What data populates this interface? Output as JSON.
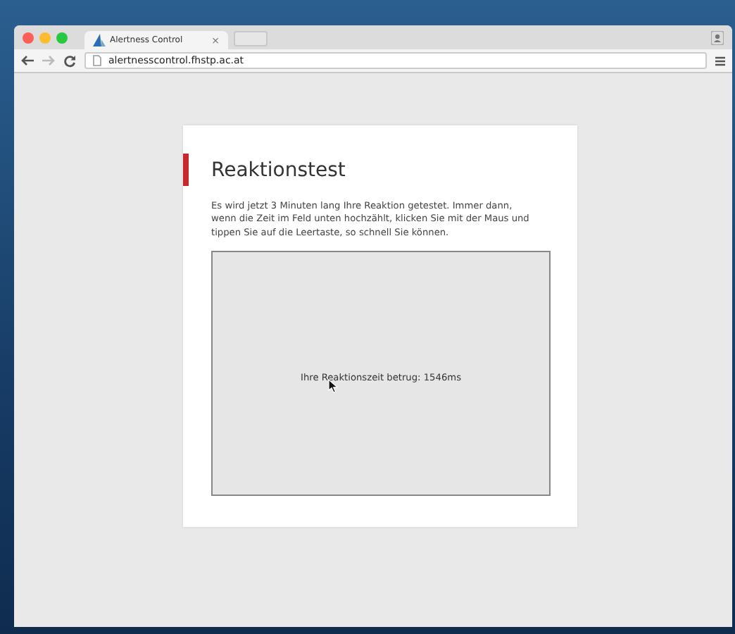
{
  "browser": {
    "tab": {
      "title": "Alertness Control",
      "close": "×",
      "selected": true
    },
    "url": "alertnesscontrol.fhstp.ac.at"
  },
  "card": {
    "title": "Reaktionstest",
    "text": "Es wird jetzt 3 Minuten lang Ihre Reaktion getestet. Immer dann, wenn die Zeit im Feld unten hochzählt, klicken Sie mit der Maus und tippen Sie auf die Leertaste, so schnell Sie können.",
    "result": "Ihre Reaktionszeit betrug: 1546ms"
  }
}
